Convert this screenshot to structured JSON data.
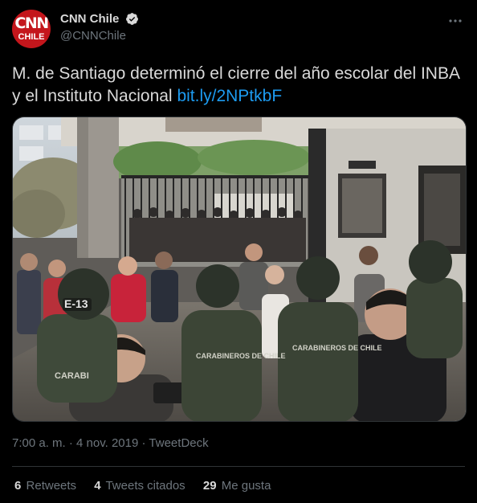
{
  "author": {
    "display_name": "CNN Chile",
    "handle": "@CNNChile",
    "avatar_text": "CNN",
    "avatar_subtext": "CHILE",
    "verified": true
  },
  "tweet": {
    "text": "M. de Santiago determinó el cierre del año escolar del INBA y el Instituto Nacional ",
    "link": "bit.ly/2NPtkbF"
  },
  "media": {
    "sign_text": "",
    "patch_e13": "E-13",
    "vest_text": "CARABINEROS DE CHILE",
    "vest_text_2": "CARABINEROS DE CHILE",
    "vest_text_3": "CARABI"
  },
  "meta": {
    "time": "7:00 a. m.",
    "date": "4 nov. 2019",
    "source": "TweetDeck",
    "dot": "·"
  },
  "stats": {
    "retweets_count": "6",
    "retweets_label": "Retweets",
    "quotes_count": "4",
    "quotes_label": "Tweets citados",
    "likes_count": "29",
    "likes_label": "Me gusta"
  },
  "colors": {
    "background": "#000000",
    "text": "#d9d9d9",
    "secondary": "#6e767d",
    "link": "#1d9bf0",
    "brand_red": "#c4161c"
  }
}
